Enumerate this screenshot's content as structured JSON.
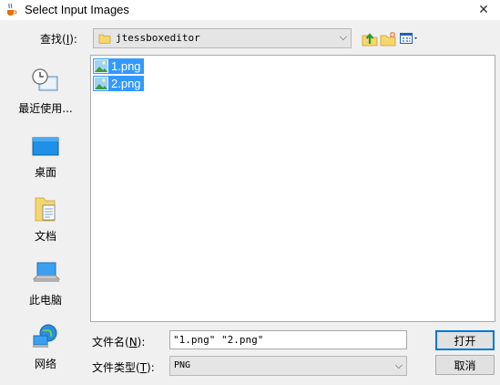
{
  "window": {
    "title": "Select Input Images",
    "close_glyph": "✕"
  },
  "lookin": {
    "label_prefix": "查找(",
    "label_mnemonic": "I",
    "label_suffix": "):",
    "value": "jtessboxeditor",
    "chevron": "⌵"
  },
  "places": [
    {
      "label": "最近使用...",
      "icon": "recent-items-icon"
    },
    {
      "label": "桌面",
      "icon": "desktop-icon"
    },
    {
      "label": "文档",
      "icon": "documents-icon"
    },
    {
      "label": "此电脑",
      "icon": "this-pc-icon"
    },
    {
      "label": "网络",
      "icon": "network-icon"
    }
  ],
  "files": [
    {
      "name": "1.png",
      "selected": true
    },
    {
      "name": "2.png",
      "selected": true
    }
  ],
  "filename_row": {
    "label_prefix": "文件名(",
    "label_mnemonic": "N",
    "label_suffix": "):",
    "value": "\"1.png\" \"2.png\""
  },
  "filetype_row": {
    "label_prefix": "文件类型(",
    "label_mnemonic": "T",
    "label_suffix": "):",
    "value": "PNG",
    "chevron": "⌵"
  },
  "buttons": {
    "open": "打开",
    "cancel": "取消"
  },
  "colors": {
    "selection": "#3399ff",
    "dialog_bg": "#f0f0f0"
  }
}
